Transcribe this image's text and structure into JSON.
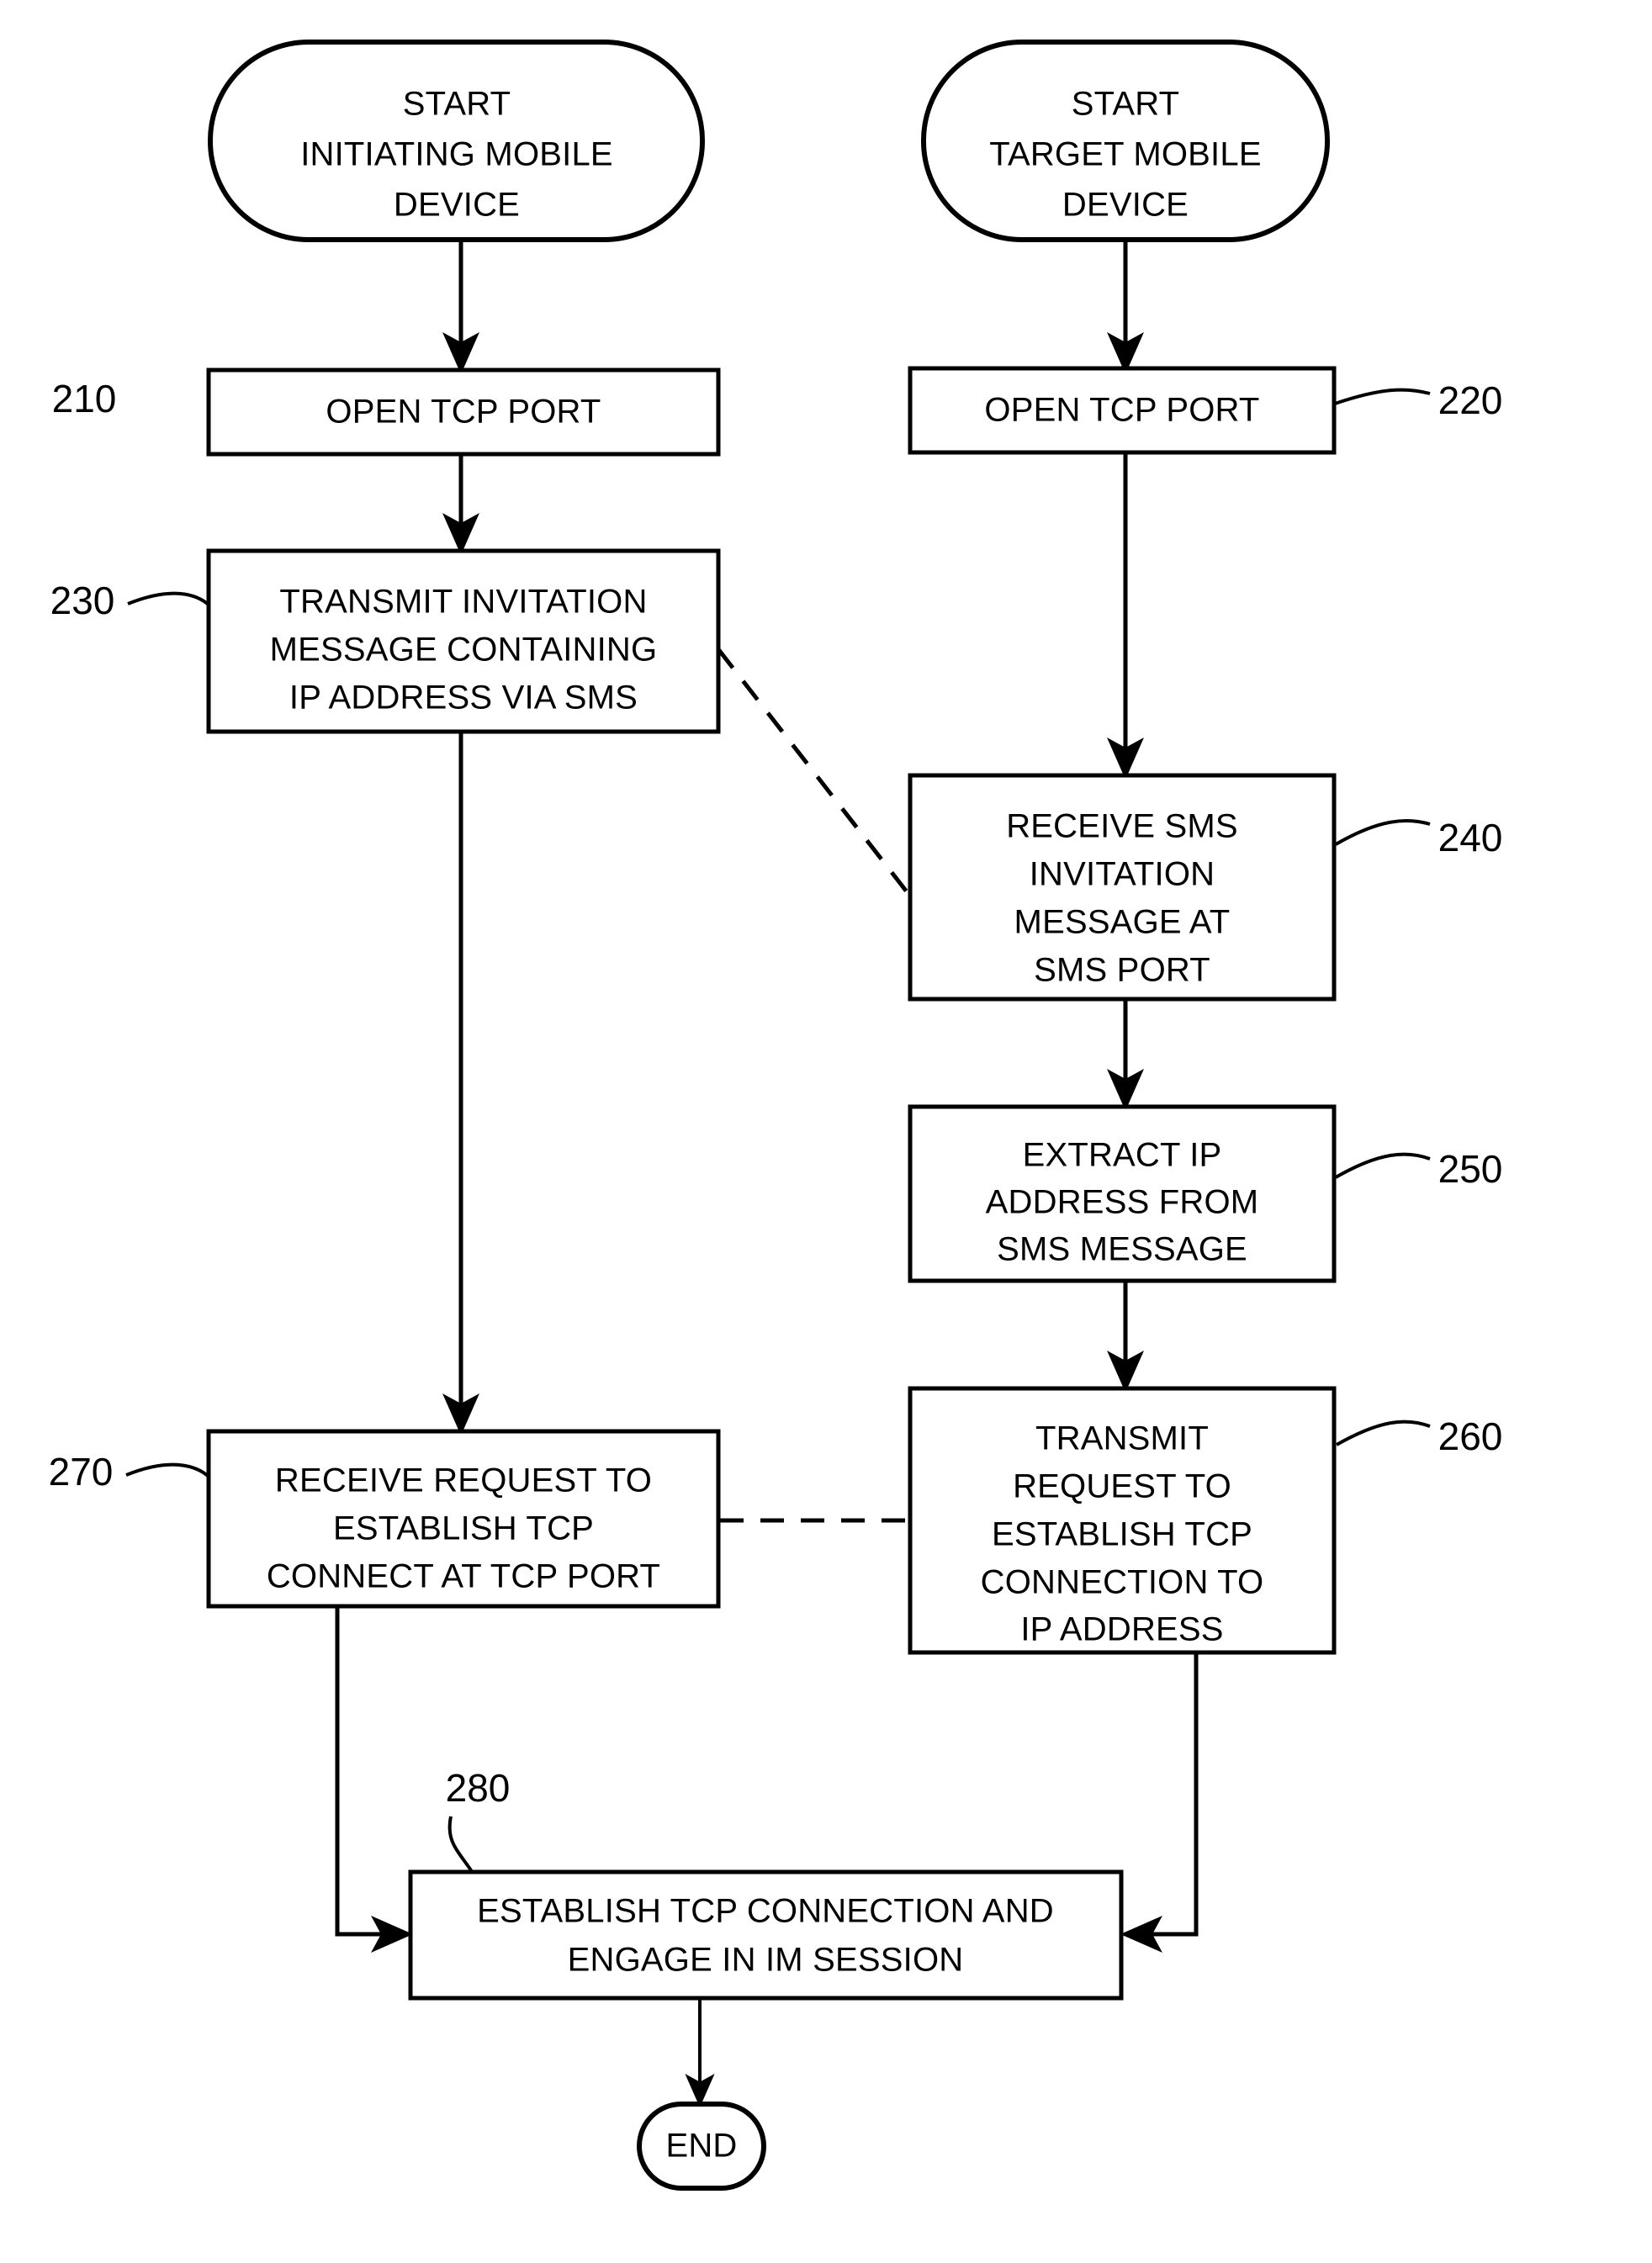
{
  "figure": {
    "type": "flowchart",
    "orientation": "two-column",
    "columns": [
      {
        "name": "initiating-mobile-device"
      },
      {
        "name": "target-mobile-device"
      }
    ]
  },
  "nodes": {
    "start_left": {
      "shape": "terminator",
      "lines": [
        "START",
        "INITIATING MOBILE",
        "DEVICE"
      ],
      "line1": "START",
      "line2": "INITIATING MOBILE",
      "line3": "DEVICE"
    },
    "start_right": {
      "shape": "terminator",
      "lines": [
        "START",
        "TARGET MOBILE",
        "DEVICE"
      ],
      "line1": "START",
      "line2": "TARGET MOBILE",
      "line3": "DEVICE"
    },
    "n210": {
      "shape": "process",
      "ref": "210",
      "lines": [
        "OPEN TCP PORT"
      ],
      "line1": "OPEN TCP PORT"
    },
    "n220": {
      "shape": "process",
      "ref": "220",
      "lines": [
        "OPEN TCP PORT"
      ],
      "line1": "OPEN TCP PORT"
    },
    "n230": {
      "shape": "process",
      "ref": "230",
      "lines": [
        "TRANSMIT INVITATION",
        "MESSAGE CONTAINING",
        "IP ADDRESS VIA SMS"
      ],
      "line1": "TRANSMIT INVITATION",
      "line2": "MESSAGE CONTAINING",
      "line3": "IP ADDRESS VIA SMS"
    },
    "n240": {
      "shape": "process",
      "ref": "240",
      "lines": [
        "RECEIVE SMS",
        "INVITATION",
        "MESSAGE AT",
        "SMS PORT"
      ],
      "line1": "RECEIVE SMS",
      "line2": "INVITATION",
      "line3": "MESSAGE AT",
      "line4": "SMS PORT"
    },
    "n250": {
      "shape": "process",
      "ref": "250",
      "lines": [
        "EXTRACT IP",
        "ADDRESS FROM",
        "SMS MESSAGE"
      ],
      "line1": "EXTRACT IP",
      "line2": "ADDRESS FROM",
      "line3": "SMS MESSAGE"
    },
    "n260": {
      "shape": "process",
      "ref": "260",
      "lines": [
        "TRANSMIT",
        "REQUEST TO",
        "ESTABLISH TCP",
        "CONNECTION TO",
        "IP ADDRESS"
      ],
      "line1": "TRANSMIT",
      "line2": "REQUEST TO",
      "line3": "ESTABLISH TCP",
      "line4": "CONNECTION TO",
      "line5": "IP ADDRESS"
    },
    "n270": {
      "shape": "process",
      "ref": "270",
      "lines": [
        "RECEIVE REQUEST TO",
        "ESTABLISH TCP",
        "CONNECT AT TCP PORT"
      ],
      "line1": "RECEIVE REQUEST TO",
      "line2": "ESTABLISH TCP",
      "line3": "CONNECT AT TCP PORT"
    },
    "n280": {
      "shape": "process",
      "ref": "280",
      "lines": [
        "ESTABLISH TCP CONNECTION AND",
        "ENGAGE IN IM SESSION"
      ],
      "line1": "ESTABLISH TCP CONNECTION AND",
      "line2": "ENGAGE IN IM SESSION"
    },
    "end": {
      "shape": "terminator",
      "lines": [
        "END"
      ],
      "line1": "END"
    }
  },
  "edges": [
    {
      "from": "start_left",
      "to": "n210",
      "style": "solid",
      "arrow": true
    },
    {
      "from": "n210",
      "to": "n230",
      "style": "solid",
      "arrow": true
    },
    {
      "from": "n230",
      "to": "n270",
      "style": "solid",
      "arrow": true
    },
    {
      "from": "n230",
      "to": "n240",
      "style": "dashed",
      "arrow": false
    },
    {
      "from": "start_right",
      "to": "n220",
      "style": "solid",
      "arrow": true
    },
    {
      "from": "n220",
      "to": "n240",
      "style": "solid",
      "arrow": true
    },
    {
      "from": "n240",
      "to": "n250",
      "style": "solid",
      "arrow": true
    },
    {
      "from": "n250",
      "to": "n260",
      "style": "solid",
      "arrow": true
    },
    {
      "from": "n260",
      "to": "n270",
      "style": "dashed",
      "arrow": false
    },
    {
      "from": "n270",
      "to": "n280",
      "style": "solid",
      "arrow": true
    },
    {
      "from": "n260",
      "to": "n280",
      "style": "solid",
      "arrow": true
    },
    {
      "from": "n280",
      "to": "end",
      "style": "solid",
      "arrow": true
    }
  ],
  "colors": {
    "stroke": "#000000",
    "fill": "#ffffff",
    "background": "#ffffff"
  }
}
